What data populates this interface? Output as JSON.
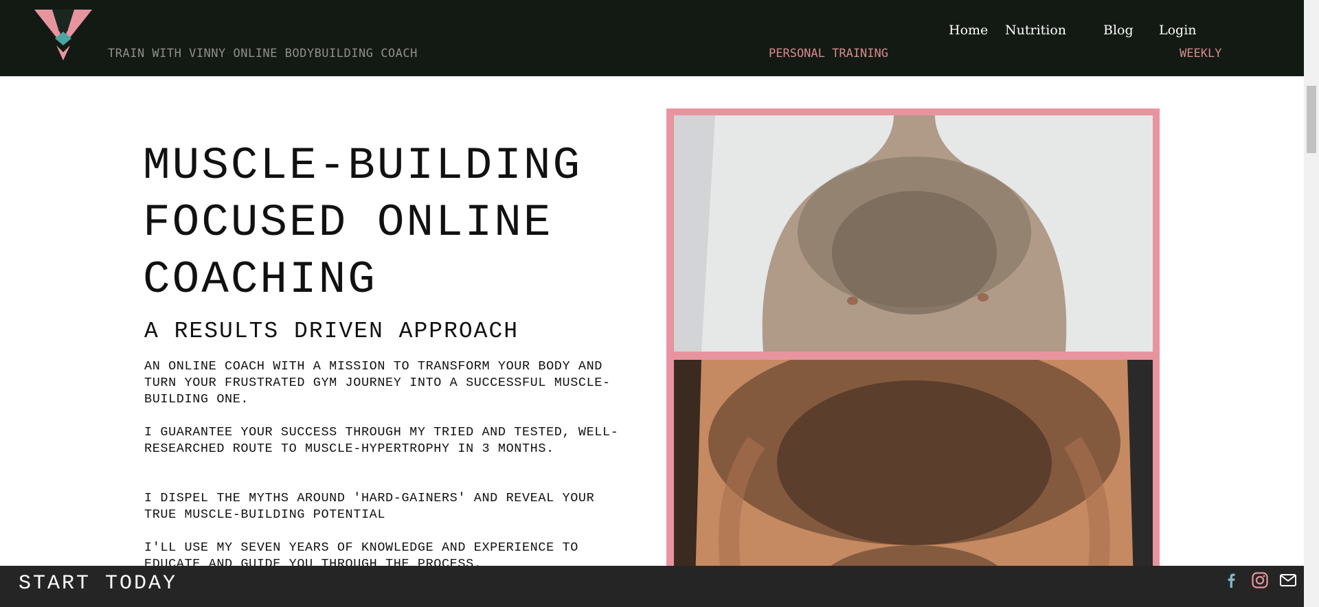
{
  "header": {
    "tagline": "TRAIN WITH VINNY ONLINE BODYBUILDING COACH",
    "nav": [
      {
        "label": "Home"
      },
      {
        "label": "Nutrition"
      },
      {
        "label": "Blog"
      },
      {
        "label": "Login"
      }
    ],
    "sub_links": {
      "personal_training": "PERSONAL TRAINING",
      "weekly": "WEEKLY"
    }
  },
  "hero": {
    "title": "MUSCLE-BUILDING FOCUSED ONLINE COACHING",
    "subtitle": "A RESULTS DRIVEN APPROACH",
    "paragraphs": [
      "AN ONLINE COACH WITH A MISSION TO TRANSFORM YOUR BODY AND TURN YOUR FRUSTRATED GYM JOURNEY INTO A SUCCESSFUL MUSCLE-BUILDING ONE.",
      "I GUARANTEE YOUR SUCCESS THROUGH MY TRIED AND TESTED, WELL-RESEARCHED ROUTE TO MUSCLE-HYPERTROPHY IN 3 MONTHS.",
      "I DISPEL THE MYTHS AROUND 'HARD-GAINERS' AND REVEAL YOUR TRUE MUSCLE-BUILDING POTENTIAL",
      "I'LL USE MY SEVEN YEARS OF KNOWLEDGE AND EXPERIENCE TO EDUCATE AND GUIDE YOU THROUGH THE PROCESS."
    ]
  },
  "footer": {
    "cta": "START TODAY",
    "icons": [
      "facebook-icon",
      "instagram-icon",
      "mail-icon"
    ]
  },
  "colors": {
    "header_bg": "#131a14",
    "accent_pink": "#e8949f",
    "footer_bg": "#252525",
    "sub_link": "#d68a8e"
  }
}
